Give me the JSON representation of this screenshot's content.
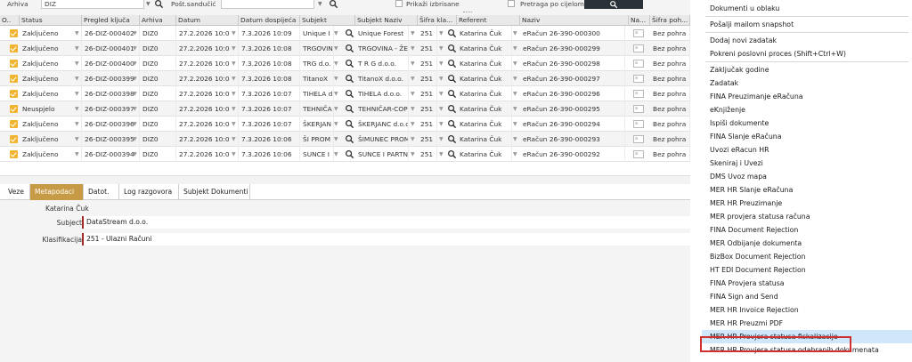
{
  "filters": {
    "arhiva_label": "Arhiva",
    "arhiva_value": "DIZ",
    "postsanducic_label": "Pošt.sandučić",
    "postsanducic_value": "",
    "prikazi_label": "Prikaži izbrisane",
    "pretraga_label": "Pretraga po cijelom tekstu"
  },
  "grid": {
    "columns": [
      "O..",
      "Status",
      "Pregled ključa",
      "Arhiva",
      "Datum",
      "Datum dospijeća",
      "Subjekt",
      "Subjekt Naziv",
      "Šifra kla...",
      "Referent",
      "Naziv",
      "Na...",
      "Šifra poh..."
    ],
    "rows": [
      {
        "status": "Zaključeno",
        "kljuc": "26-DIZ-000402",
        "arhiva": "DIZ0",
        "datum": "27.2.2026 10:0",
        "dospijece": "7.3.2026 10:09",
        "subjekt": "Unique I",
        "naziv": "Unique Forest",
        "sifra": "251",
        "referent": "Katarina Čuk",
        "dokument": "eRačun 26-390-000300",
        "pohrana": "Bez pohra"
      },
      {
        "status": "Zaključeno",
        "kljuc": "26-DIZ-000401",
        "arhiva": "DIZ0",
        "datum": "27.2.2026 10:0",
        "dospijece": "7.3.2026 10:08",
        "subjekt": "TRGOVIN",
        "naziv": "TRGOVINA - ŽE",
        "sifra": "251",
        "referent": "Katarina Čuk",
        "dokument": "eRačun 26-390-000299",
        "pohrana": "Bez pohra"
      },
      {
        "status": "Zaključeno",
        "kljuc": "26-DIZ-000400",
        "arhiva": "DIZ0",
        "datum": "27.2.2026 10:0",
        "dospijece": "7.3.2026 10:08",
        "subjekt": "TRG d.o.",
        "naziv": "T R G d.o.o.",
        "sifra": "251",
        "referent": "Katarina Čuk",
        "dokument": "eRačun 26-390-000298",
        "pohrana": "Bez pohra"
      },
      {
        "status": "Zaključeno",
        "kljuc": "26-DIZ-000399",
        "arhiva": "DIZ0",
        "datum": "27.2.2026 10:0",
        "dospijece": "7.3.2026 10:08",
        "subjekt": "TitanoX",
        "naziv": "TitanoX d.o.o.",
        "sifra": "251",
        "referent": "Katarina Čuk",
        "dokument": "eRačun 26-390-000297",
        "pohrana": "Bez pohra"
      },
      {
        "status": "Zaključeno",
        "kljuc": "26-DIZ-000398",
        "arhiva": "DIZ0",
        "datum": "27.2.2026 10:0",
        "dospijece": "7.3.2026 10:07",
        "subjekt": "TIHELA d",
        "naziv": "TIHELA d.o.o.",
        "sifra": "251",
        "referent": "Katarina Čuk",
        "dokument": "eRačun 26-390-000296",
        "pohrana": "Bez pohra"
      },
      {
        "status": "Neuspjelo",
        "kljuc": "26-DIZ-000397",
        "arhiva": "DIZ0",
        "datum": "27.2.2026 10:0",
        "dospijece": "7.3.2026 10:07",
        "subjekt": "TEHNIČA",
        "naziv": "TEHNIČAR-COP",
        "sifra": "251",
        "referent": "Katarina Čuk",
        "dokument": "eRačun 26-390-000295",
        "pohrana": "Bez pohra"
      },
      {
        "status": "Zaključeno",
        "kljuc": "26-DIZ-000396",
        "arhiva": "DIZ0",
        "datum": "27.2.2026 10:0",
        "dospijece": "7.3.2026 10:07",
        "subjekt": "ŠKERJAN",
        "naziv": "ŠKERJANC d.o.c",
        "sifra": "251",
        "referent": "Katarina Čuk",
        "dokument": "eRačun 26-390-000294",
        "pohrana": "Bez pohra"
      },
      {
        "status": "Zaključeno",
        "kljuc": "26-DIZ-000395",
        "arhiva": "DIZ0",
        "datum": "27.2.2026 10:0",
        "dospijece": "7.3.2026 10:06",
        "subjekt": "ŠI PROM",
        "naziv": "ŠIMUNEC PROM",
        "sifra": "251",
        "referent": "Katarina Čuk",
        "dokument": "eRačun 26-390-000293",
        "pohrana": "Bez pohra"
      },
      {
        "status": "Zaključeno",
        "kljuc": "26-DIZ-000394",
        "arhiva": "DIZ0",
        "datum": "27.2.2026 10:0",
        "dospijece": "7.3.2026 10:06",
        "subjekt": "SUNCE I",
        "naziv": "SUNCE I PARTN",
        "sifra": "251",
        "referent": "Katarina Čuk",
        "dokument": "eRačun 26-390-000292",
        "pohrana": "Bez pohra"
      }
    ]
  },
  "tabs": [
    "Veze",
    "Metapodaci",
    "Datot.",
    "Log razgovora",
    "Subjekt Dokumenti"
  ],
  "active_tab": "Metapodaci",
  "details": {
    "referent_value": "Katarina Čuk",
    "subject_label": "Subject",
    "subject_value": "DataStream d.o.o.",
    "klasifikacija_label": "Klasifikacija",
    "klasifikacija_value": "251 - Ulazni Računi"
  },
  "menu": {
    "items": [
      "Dokumenti u oblaku",
      "Pošalji mailom snapshot",
      "Dodaj novi zadatak",
      "Pokreni poslovni proces (Shift+Ctrl+W)",
      "Zaključak godine",
      "Zadatak",
      "FINA Preuzimanje eRačuna",
      "eKnjiženje",
      "Ispiši dokumente",
      "FINA Slanje eRačuna",
      "Uvozi eRacun HR",
      "Skeniraj i Uvezi",
      "DMS Uvoz mapa",
      "MER HR Slanje eRačuna",
      "MER HR Preuzimanje",
      "MER provjera statusa računa",
      "FINA Document Rejection",
      "MER Odbijanje dokumenta",
      "BizBox Document Rejection",
      "HT EDI Document Rejection",
      "FINA Provjera statusa",
      "FINA Sign and Send",
      "MER HR Invoice Rejection",
      "MER HR Preuzmi PDF",
      "MER HR Provjera statusa fiskalizacije",
      "MER HR Provjera statusa odabranih dokumenata"
    ],
    "highlighted": "MER HR Provjera statusa fiskalizacije"
  },
  "colors": {
    "accent_tab": "#c79a45",
    "checkbox": "#f0b431",
    "highlight_box": "#d0302f",
    "menu_highlight": "#cfe6fb"
  }
}
